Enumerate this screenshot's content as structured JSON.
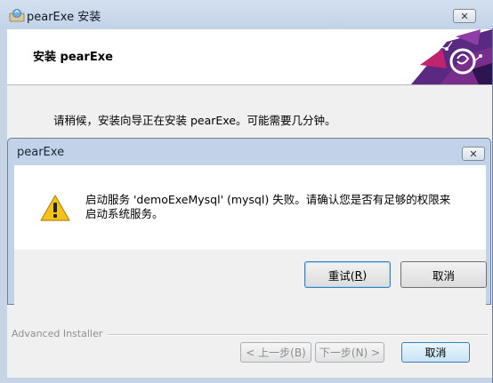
{
  "window": {
    "title": "pearExe 安装",
    "close_glyph": "✕"
  },
  "header": {
    "title": "安装 pearExe",
    "logo_icon": "advanced-installer-logo-icon"
  },
  "progress": {
    "text": "请稍候，安装向导正在安装 pearExe。可能需要几分钟。"
  },
  "branding": {
    "text": "Advanced Installer"
  },
  "wizard_buttons": {
    "back": "< 上一步(B)",
    "next": "下一步(N) >",
    "cancel": "取消"
  },
  "dialog": {
    "title": "pearExe",
    "close_glyph": "✕",
    "icon": "warning-icon",
    "message_line1": "启动服务 'demoExeMysql' (mysql) 失败。请确认您是否有足够的权限来",
    "message_line2": "启动系统服务。",
    "retry_prefix": "重试(",
    "retry_mnemonic": "R",
    "retry_suffix": ")",
    "cancel": "取消"
  },
  "colors": {
    "title_bar": "#c6d4e6",
    "accent": "#3c7fb1",
    "logo_purple": "#5a2a82",
    "logo_magenta": "#c0246e",
    "warning_yellow": "#f4c21a"
  }
}
